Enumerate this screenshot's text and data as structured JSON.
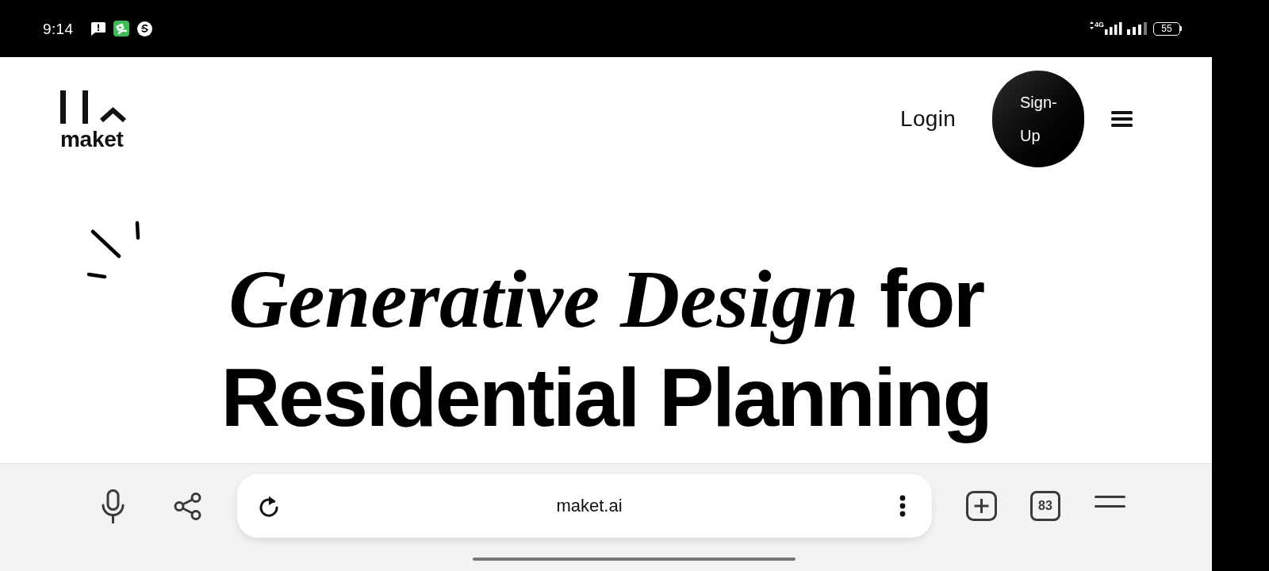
{
  "status_bar": {
    "time": "9:14",
    "network_type": "4G",
    "battery": "55"
  },
  "header": {
    "logo_text": "maket",
    "nav": [
      {
        "kind": "link",
        "label": "Login"
      },
      {
        "kind": "button",
        "label": "Sign-Up"
      }
    ]
  },
  "hero": {
    "heading": "*Generative Design* for Residential Planning"
  },
  "browser_bar": {
    "url": "maket.ai",
    "tab_count": "83"
  }
}
